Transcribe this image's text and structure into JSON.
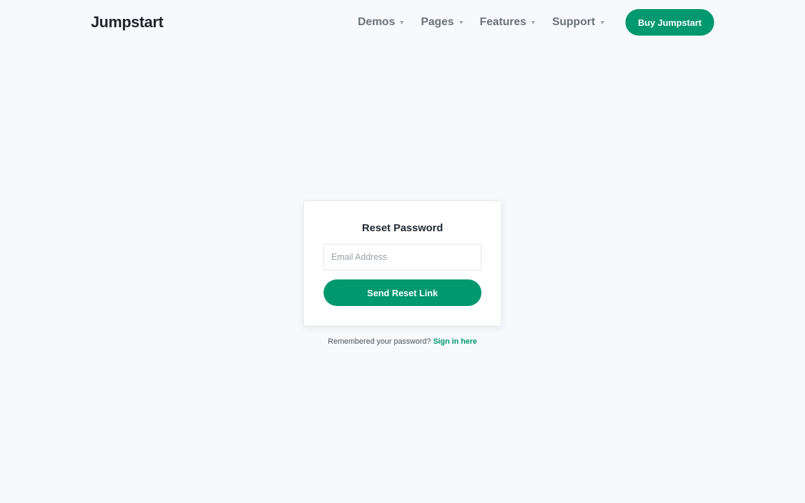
{
  "navbar": {
    "brand": "Jumpstart",
    "items": [
      {
        "label": "Demos",
        "icon": "caret-down-icon"
      },
      {
        "label": "Pages",
        "icon": "caret-down-icon"
      },
      {
        "label": "Features",
        "icon": "caret-down-icon"
      },
      {
        "label": "Support",
        "icon": "caret-down-icon"
      }
    ],
    "cta_label": "Buy Jumpstart"
  },
  "reset_form": {
    "title": "Reset Password",
    "email_placeholder": "Email Address",
    "email_value": "",
    "submit_label": "Send Reset Link"
  },
  "footer_note": {
    "text": "Remembered your password?",
    "link_label": "Sign in here"
  },
  "colors": {
    "accent": "#00986f",
    "background": "#f7f9fc",
    "nav_text": "#6c7278",
    "card_bg": "#ffffff"
  }
}
